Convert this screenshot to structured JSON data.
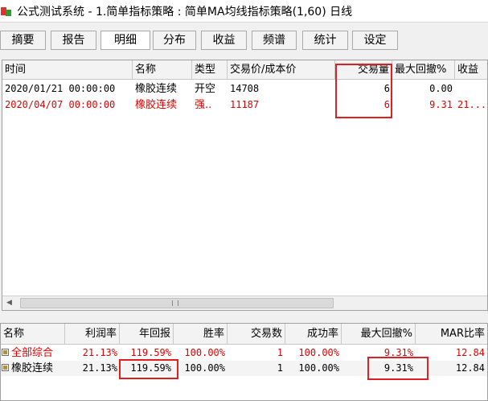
{
  "window": {
    "title": "公式测试系统 - 1.简单指标策略 : 简单MA均线指标策略(1,60) 日线"
  },
  "tabs": [
    {
      "label": "摘要",
      "active": false
    },
    {
      "label": "报告",
      "active": false
    },
    {
      "label": "明细",
      "active": true
    },
    {
      "label": "分布",
      "active": false
    },
    {
      "label": "收益",
      "active": false
    },
    {
      "label": "频谱",
      "active": false
    },
    {
      "label": "统计",
      "active": false
    },
    {
      "label": "设定",
      "active": false
    }
  ],
  "detail_table": {
    "columns": [
      "时间",
      "名称",
      "类型",
      "交易价/成本价",
      "交易量",
      "最大回撤%",
      "收益"
    ],
    "rows": [
      {
        "time": "2020/01/21 00:00:00",
        "name": "橡胶连续",
        "type": "开空",
        "price": "14708",
        "volume": "6",
        "max_drawdown": "0.00",
        "profit": "",
        "color": "#000000"
      },
      {
        "time": "2020/04/07 00:00:00",
        "name": "橡胶连续",
        "type": "强..",
        "price": "11187",
        "volume": "6",
        "max_drawdown": "9.31",
        "profit": "21...",
        "color": "#e00000"
      }
    ]
  },
  "summary_table": {
    "columns": [
      "名称",
      "利润率",
      "年回报",
      "胜率",
      "交易数",
      "成功率",
      "最大回撤%",
      "MAR比率"
    ],
    "rows": [
      {
        "name": "全部综合",
        "profit_rate": "21.13%",
        "annual_return": "119.59%",
        "win_rate": "100.00%",
        "trades": "1",
        "success_rate": "100.00%",
        "max_drawdown": "9.31%",
        "mar": "12.84",
        "color": "#e00000"
      },
      {
        "name": "橡胶连续",
        "profit_rate": "21.13%",
        "annual_return": "119.59%",
        "win_rate": "100.00%",
        "trades": "1",
        "success_rate": "100.00%",
        "max_drawdown": "9.31%",
        "mar": "12.84",
        "color": "#000000"
      }
    ]
  },
  "colors": {
    "highlight": "#e02020",
    "loss_red": "#e00000"
  }
}
